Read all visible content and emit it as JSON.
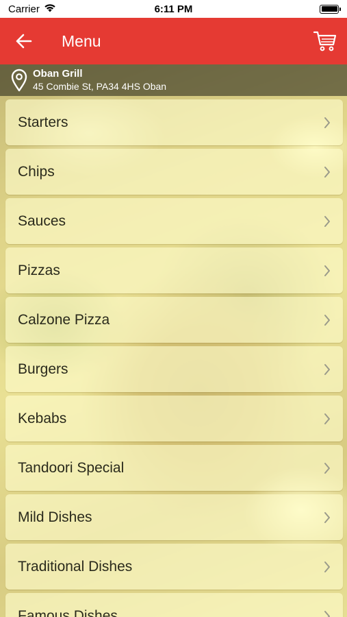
{
  "status_bar": {
    "carrier": "Carrier",
    "time": "6:11 PM",
    "battery_level": 1.0
  },
  "nav": {
    "title": "Menu",
    "back_icon": "arrow-left-icon",
    "cart_icon": "cart-icon"
  },
  "location": {
    "name": "Oban Grill",
    "address": "45 Combie St, PA34 4HS Oban"
  },
  "menu": {
    "items": [
      {
        "label": "Starters"
      },
      {
        "label": "Chips"
      },
      {
        "label": "Sauces"
      },
      {
        "label": "Pizzas"
      },
      {
        "label": "Calzone Pizza"
      },
      {
        "label": "Burgers"
      },
      {
        "label": "Kebabs"
      },
      {
        "label": "Tandoori Special"
      },
      {
        "label": "Mild Dishes"
      },
      {
        "label": "Traditional Dishes"
      },
      {
        "label": "Famous Dishes"
      }
    ]
  },
  "colors": {
    "brand": "#e53a33",
    "overlay": "#fffaa8"
  }
}
